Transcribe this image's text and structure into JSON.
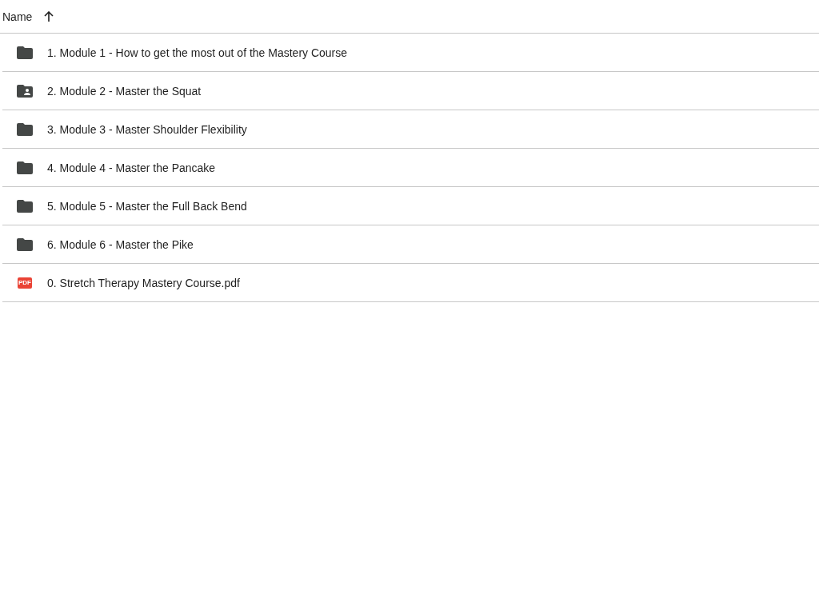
{
  "header": {
    "column": "Name",
    "sort_ascending": true
  },
  "rows": [
    {
      "kind": "folder",
      "name": "1. Module 1 - How to get the most out of the Mastery Course"
    },
    {
      "kind": "shared-folder",
      "name": "2. Module 2 - Master the Squat"
    },
    {
      "kind": "folder",
      "name": "3. Module 3 - Master Shoulder Flexibility"
    },
    {
      "kind": "folder",
      "name": "4. Module 4 - Master the Pancake"
    },
    {
      "kind": "folder",
      "name": "5. Module 5 - Master the Full Back Bend"
    },
    {
      "kind": "folder",
      "name": "6. Module 6 - Master the Pike"
    },
    {
      "kind": "pdf",
      "name": "0. Stretch Therapy Mastery Course.pdf",
      "badge": "PDF"
    }
  ]
}
